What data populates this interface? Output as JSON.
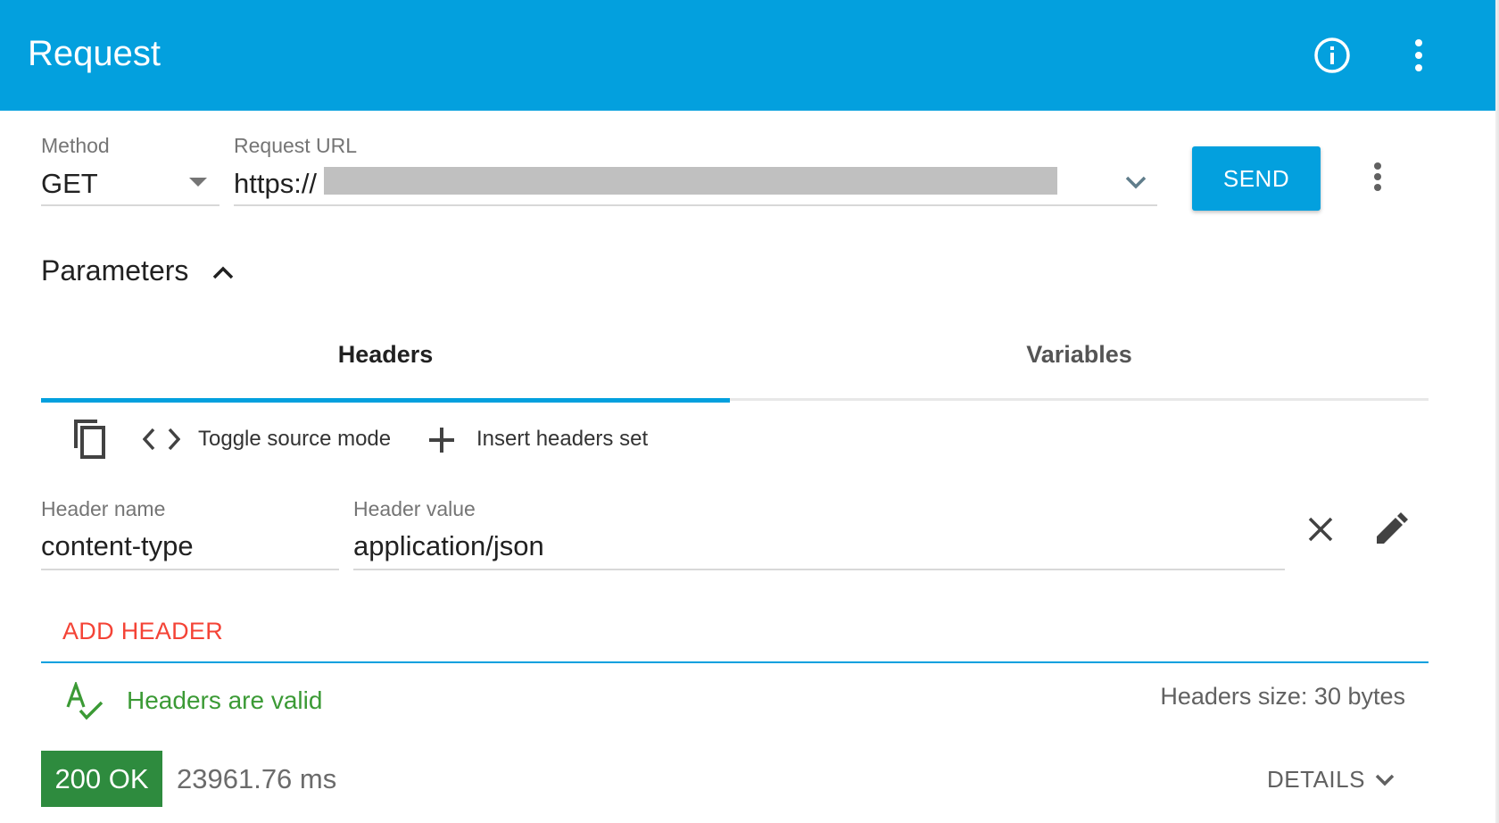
{
  "appbar": {
    "title": "Request",
    "info_icon": "info-icon",
    "menu_icon": "more-vert-icon"
  },
  "request": {
    "method_label": "Method",
    "method_value": "GET",
    "url_label": "Request URL",
    "url_value": "https://",
    "send_label": "SEND"
  },
  "parameters": {
    "title": "Parameters",
    "tabs": [
      {
        "label": "Headers",
        "active": true
      },
      {
        "label": "Variables",
        "active": false
      }
    ],
    "toolbar": {
      "toggle_source": "Toggle source mode",
      "insert_set": "Insert headers set"
    },
    "header_row": {
      "name_label": "Header name",
      "name_value": "content-type",
      "value_label": "Header value",
      "value_value": "application/json"
    },
    "add_header": "ADD HEADER",
    "validity": "Headers are valid",
    "size": "Headers size: 30 bytes"
  },
  "response": {
    "status": "200 OK",
    "time": "23961.76 ms",
    "details": "DETAILS"
  },
  "colors": {
    "accent": "#03a0de",
    "success": "#2e8b3e",
    "valid_text": "#3b9a35",
    "add_header": "#f44336"
  }
}
